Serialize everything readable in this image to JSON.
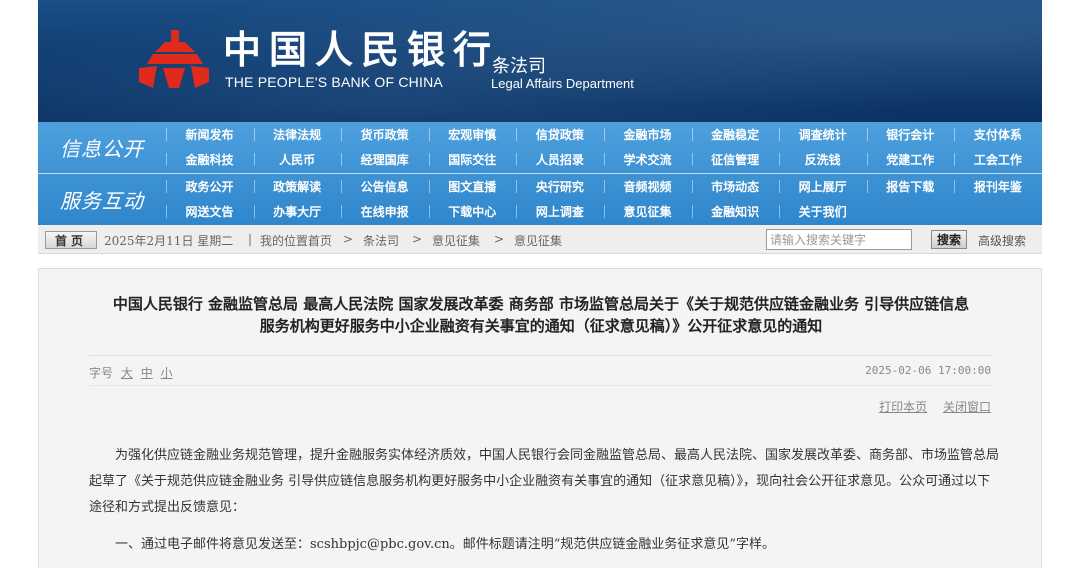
{
  "banner": {
    "bank_name_cn": "中国人民银行",
    "bank_name_en": "THE PEOPLE'S BANK OF CHINA",
    "dept_cn": "条法司",
    "dept_en": "Legal Affairs Department",
    "logo_icon": "pboc-logo-icon",
    "logo_color": "#e02a1c",
    "background_color": "#0f3d72"
  },
  "nav": {
    "accent_color": "#3a8fd2",
    "group1": {
      "title": "信息公开",
      "row1": [
        "新闻发布",
        "法律法规",
        "货币政策",
        "宏观审慎",
        "信贷政策",
        "金融市场",
        "金融稳定",
        "调查统计",
        "银行会计",
        "支付体系"
      ],
      "row2": [
        "金融科技",
        "人民币",
        "经理国库",
        "国际交往",
        "人员招录",
        "学术交流",
        "征信管理",
        "反洗钱",
        "党建工作",
        "工会工作"
      ]
    },
    "group2": {
      "title": "服务互动",
      "row1": [
        "政务公开",
        "政策解读",
        "公告信息",
        "图文直播",
        "央行研究",
        "音频视频",
        "市场动态",
        "网上展厅",
        "报告下载",
        "报刊年鉴"
      ],
      "row2": [
        "网送文告",
        "办事大厅",
        "在线申报",
        "下载中心",
        "网上调查",
        "意见征集",
        "金融知识",
        "关于我们"
      ]
    }
  },
  "util": {
    "home": "首页",
    "date": "2025年2月11日 星期二",
    "sep": "|",
    "location_label": "我的位置:",
    "crumb1": "首页",
    "crumb2": "条法司",
    "crumb3": "意见征集",
    "crumb4": "意见征集",
    "arrow": ">",
    "search_placeholder": "请输入搜索关键字",
    "search_button": "搜索",
    "advanced_search": "高级搜索"
  },
  "article": {
    "title_line1": "中国人民银行 金融监管总局 最高人民法院 国家发展改革委 商务部 市场监管总局关于《关于规范供应链金融业务 引导供应链信息",
    "title_line2": "服务机构更好服务中小企业融资有关事宜的通知（征求意见稿）》公开征求意见的通知",
    "font_size_label": "字号",
    "font_large": "大",
    "font_medium": "中",
    "font_small": "小",
    "publish_time": "2025-02-06 17:00:00",
    "print_page": "打印本页",
    "close_window": "关闭窗口",
    "paragraph1": "为强化供应链金融业务规范管理，提升金融服务实体经济质效，中国人民银行会同金融监管总局、最高人民法院、国家发展改革委、商务部、市场监管总局起草了《关于规范供应链金融业务 引导供应链信息服务机构更好服务中小企业融资有关事宜的通知（征求意见稿）》，现向社会公开征求意见。公众可通过以下途径和方式提出反馈意见：",
    "paragraph2": "一、通过电子邮件将意见发送至：scshbpjc@pbc.gov.cn。邮件标题请注明“规范供应链金融业务征求意见”字样。"
  }
}
